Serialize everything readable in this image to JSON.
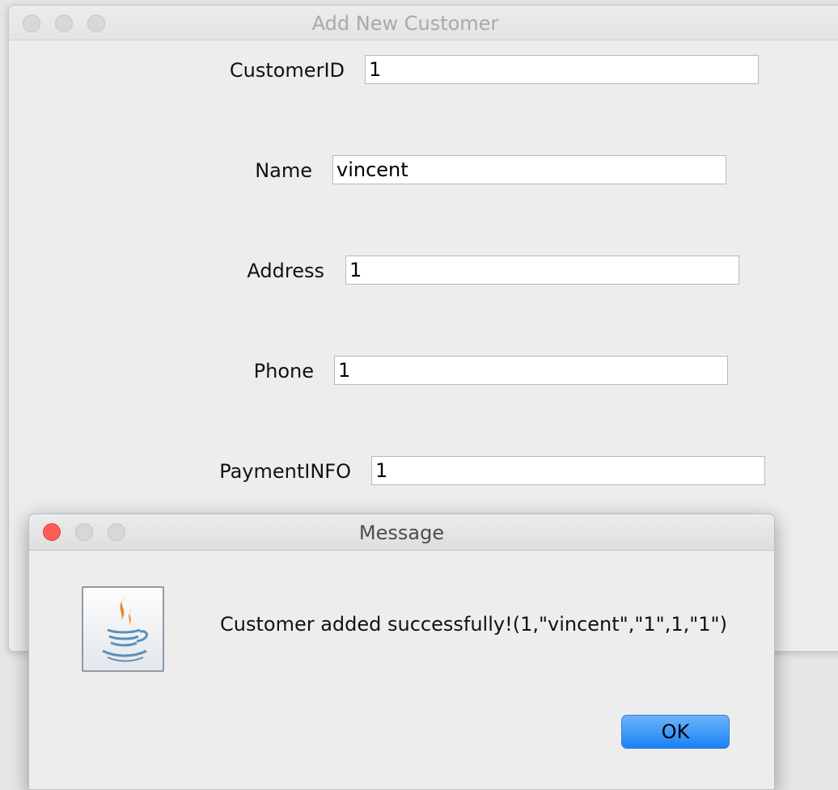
{
  "main_window": {
    "title": "Add New Customer",
    "fields": [
      {
        "label": "CustomerID",
        "value": "1"
      },
      {
        "label": "Name",
        "value": "vincent"
      },
      {
        "label": "Address",
        "value": "1"
      },
      {
        "label": "Phone",
        "value": "1"
      },
      {
        "label": "PaymentINFO",
        "value": "1"
      }
    ]
  },
  "dialog": {
    "title": "Message",
    "icon": "java-icon",
    "message": "Customer added successfully!(1,\"vincent\",\"1\",1,\"1\")",
    "ok_label": "OK"
  },
  "colors": {
    "close_button": "#fd5f57",
    "ok_button": "#1b82f5",
    "window_bg": "#ededed"
  }
}
